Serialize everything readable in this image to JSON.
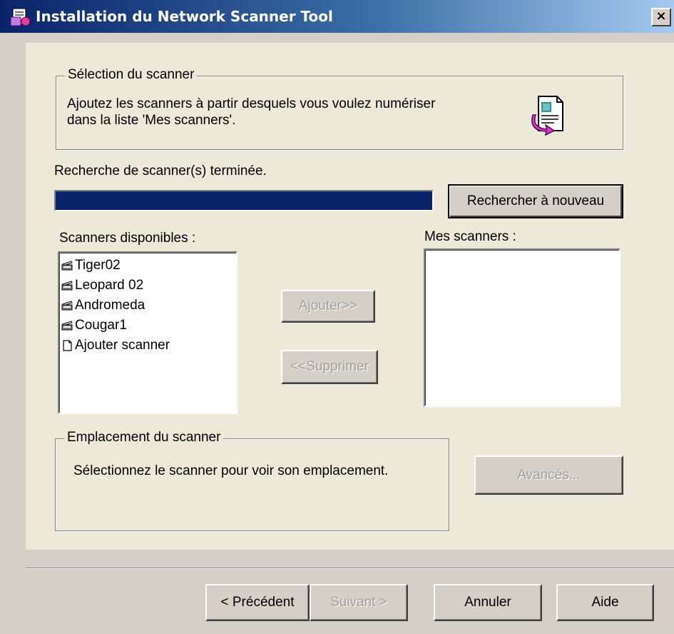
{
  "window": {
    "title": "Installation du Network Scanner Tool",
    "close_label": "×"
  },
  "selection": {
    "legend": "Sélection du scanner",
    "line1": "Ajoutez les scanners à partir desquels vous voulez numériser",
    "line2": "dans la liste 'Mes scanners'.",
    "icon": "document-arrow-icon"
  },
  "search": {
    "status": "Recherche de scanner(s) terminée.",
    "progress": 1.0,
    "rescan_label": "Rechercher à nouveau"
  },
  "available": {
    "label": "Scanners disponibles :",
    "items": [
      {
        "label": "Tiger02",
        "icon": "scanner-icon"
      },
      {
        "label": "Leopard 02",
        "icon": "scanner-icon"
      },
      {
        "label": "Andromeda",
        "icon": "scanner-icon"
      },
      {
        "label": "Cougar1",
        "icon": "scanner-icon"
      },
      {
        "label": "Ajouter scanner",
        "icon": "page-icon"
      }
    ]
  },
  "mine": {
    "label": "Mes scanners :",
    "items": []
  },
  "actions": {
    "add_label": "Ajouter>>",
    "remove_label": "<<Supprimer"
  },
  "location": {
    "legend": "Emplacement du scanner",
    "text": "Sélectionnez le scanner pour voir son emplacement.",
    "advanced_label": "Avancés..."
  },
  "footer": {
    "back_label": "< Précédent",
    "next_label": "Suivant >",
    "cancel_label": "Annuler",
    "help_label": "Aide"
  },
  "colors": {
    "title_start": "#0a246a",
    "title_end": "#a6caf0",
    "progress_fill": "#0a246a",
    "dialog_bg": "#d4d0c8",
    "panel_bg": "#ece9d8"
  }
}
